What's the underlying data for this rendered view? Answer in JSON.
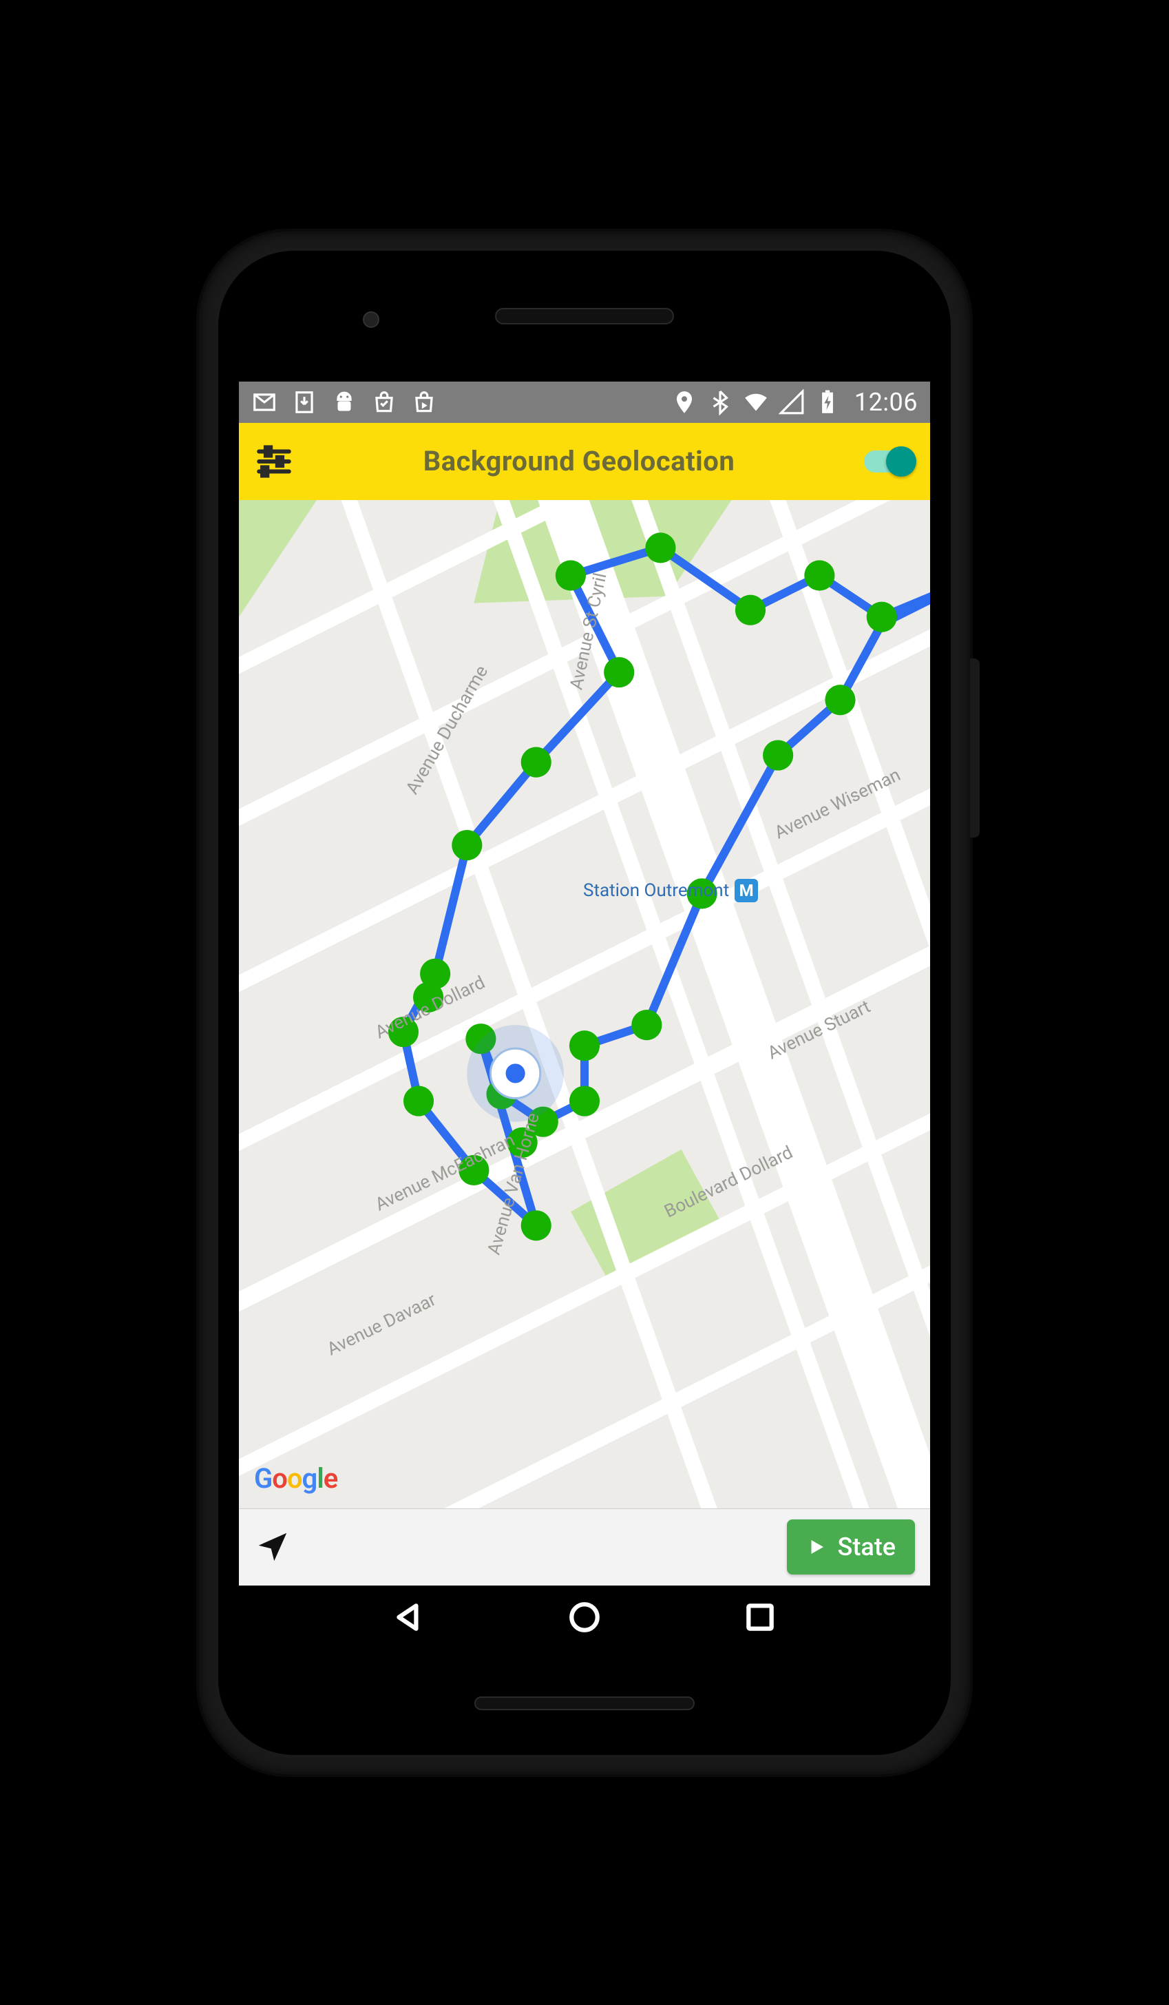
{
  "status": {
    "time": "12:06",
    "icons_left": [
      "mail-icon",
      "download-icon",
      "android-icon",
      "store1-icon",
      "store2-icon"
    ],
    "icons_right": [
      "location-icon",
      "bluetooth-icon",
      "wifi-icon",
      "cell-icon",
      "battery-icon"
    ]
  },
  "header": {
    "title": "Background Geolocation",
    "toggle_on": true
  },
  "map": {
    "provider": "Google",
    "station_label": "Station Outremont",
    "station_badge": "M",
    "streets": [
      "Avenue Ducharme",
      "Avenue St Cyril",
      "Avenue Wiseman",
      "Avenue Dollard",
      "Avenue Stuart",
      "Avenue McEachran",
      "Avenue Van Horne",
      "Boulevard Dollard",
      "Avenue Davaar"
    ]
  },
  "bottom": {
    "state_label": "State"
  }
}
